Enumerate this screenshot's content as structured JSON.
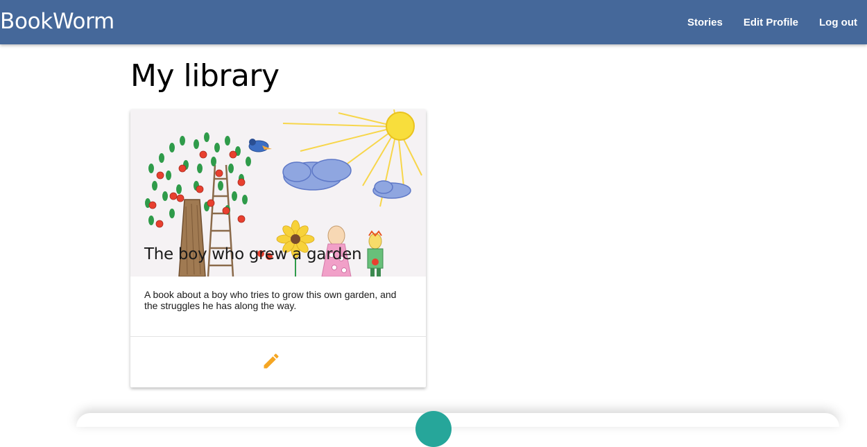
{
  "colors": {
    "brand": "#45689a",
    "accent_edit": "#f5a623",
    "fab": "#26a69a"
  },
  "navbar": {
    "brand": "BookWorm",
    "links": [
      "Stories",
      "Edit Profile",
      "Log out"
    ]
  },
  "main": {
    "title": "My library",
    "books": [
      {
        "title": "The boy who grew a garden",
        "description": "A book about a boy who tries to grow this own garden, and the struggles he has along the way.",
        "action_icon": "pencil-icon"
      }
    ]
  },
  "fab": {
    "icon": "add-icon"
  }
}
